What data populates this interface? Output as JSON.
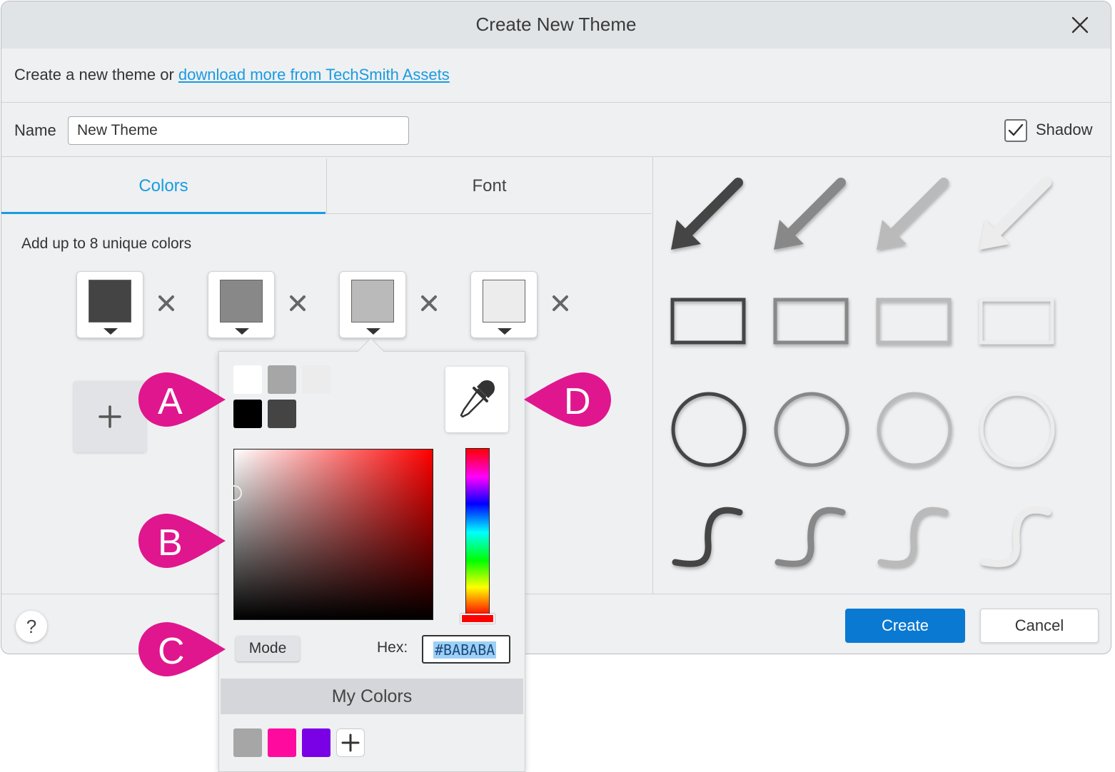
{
  "dialog": {
    "title": "Create New Theme",
    "intro_text": "Create a new theme or ",
    "intro_link": "download more from TechSmith Assets",
    "name_label": "Name",
    "name_value": "New Theme",
    "shadow_label": "Shadow",
    "shadow_checked": true
  },
  "tabs": [
    {
      "label": "Colors",
      "active": true
    },
    {
      "label": "Font",
      "active": false
    }
  ],
  "colors_panel": {
    "hint": "Add up to 8 unique colors",
    "theme_colors": [
      "#444444",
      "#888888",
      "#bababa",
      "#ececec"
    ]
  },
  "color_picker": {
    "preset_colors": [
      "#ffffff",
      "#a6a6a6",
      "#ececec",
      "#000000",
      "#444444"
    ],
    "mode_label": "Mode",
    "hex_label": "Hex:",
    "hex_value": "#BABABA",
    "my_colors_label": "My Colors",
    "my_colors": [
      "#a6a6a6",
      "#ff0a9e",
      "#7a00e6"
    ]
  },
  "callouts": [
    "A",
    "B",
    "C",
    "D"
  ],
  "footer": {
    "help_label": "?",
    "create_label": "Create",
    "cancel_label": "Cancel"
  },
  "colors": {
    "accent": "#1a9be0",
    "primary_button": "#0a79d2",
    "callout": "#e0168e"
  }
}
